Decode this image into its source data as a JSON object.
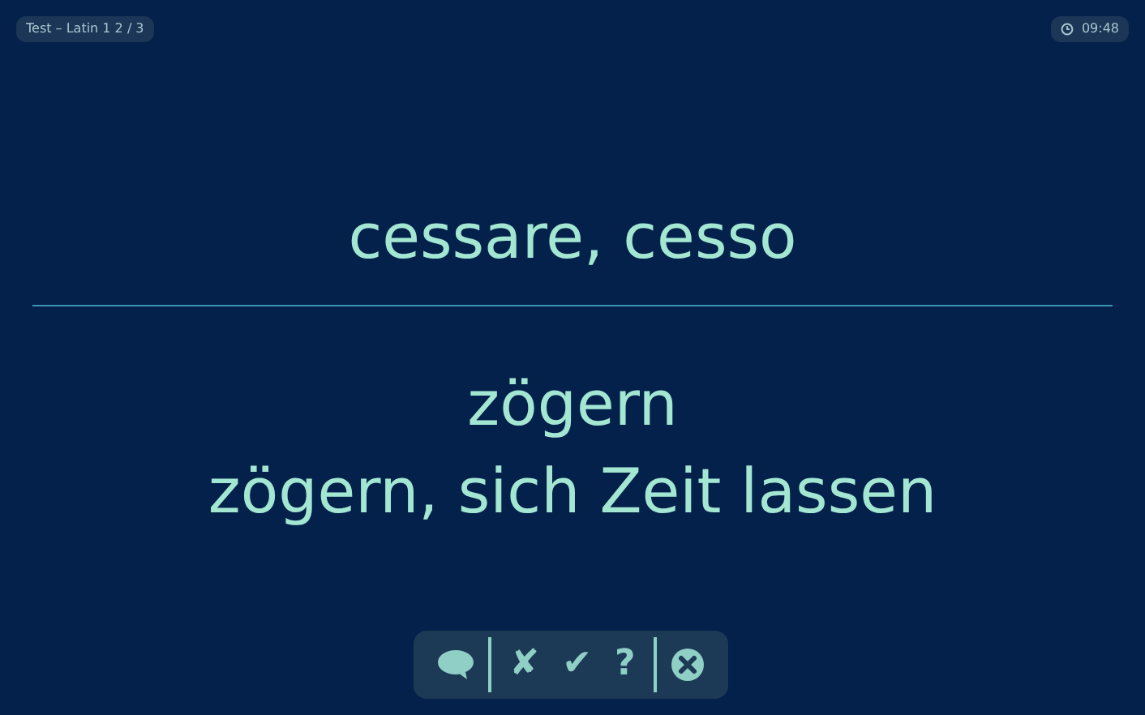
{
  "header": {
    "title": "Test – Latin 1 2 / 3",
    "time": "09:48"
  },
  "card": {
    "question": "cessare, cesso",
    "answers": [
      "zögern",
      "zögern, sich Zeit lassen"
    ]
  },
  "toolbar": {
    "buttons": [
      {
        "kind": "comment"
      },
      {
        "kind": "divider"
      },
      {
        "kind": "glyph",
        "label": "✘"
      },
      {
        "kind": "glyph",
        "label": "✔"
      },
      {
        "kind": "glyph",
        "label": "?"
      },
      {
        "kind": "divider"
      },
      {
        "kind": "close"
      }
    ]
  }
}
